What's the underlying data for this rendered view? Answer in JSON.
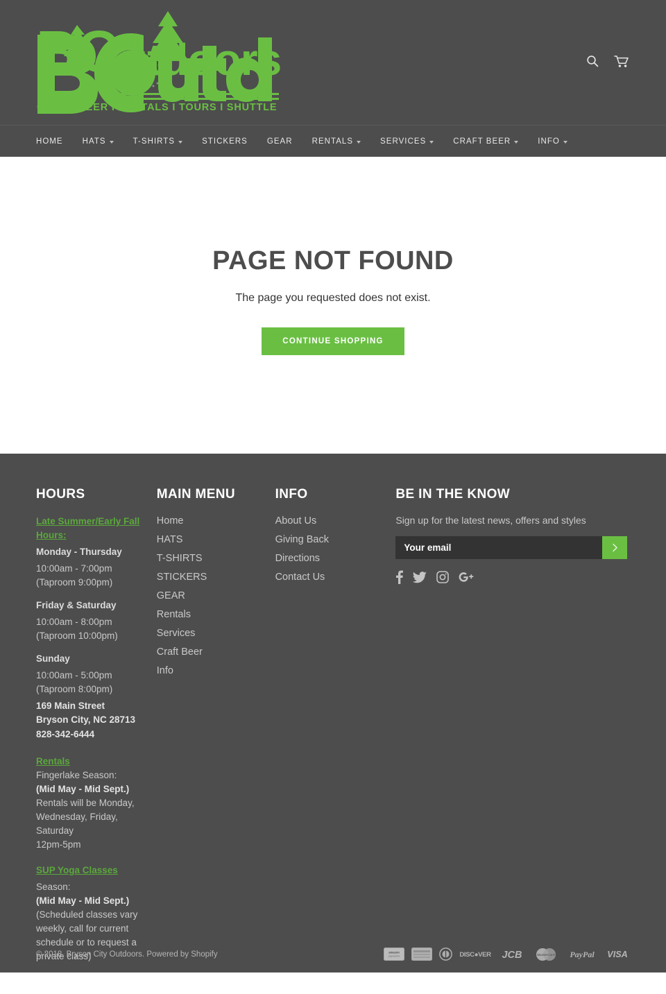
{
  "header": {
    "logo": {
      "brand_prefix": "BC",
      "brand_suffix": "utdoors",
      "brand_full": "BC Outdoors",
      "tagline": "GEAR I BEER I RENTALS I TOURS I SHUTTLE",
      "color": "#6ABF43"
    },
    "icons": {
      "search": "search-icon",
      "cart": "cart-icon"
    }
  },
  "nav": {
    "items": [
      {
        "label": "HOME",
        "has_dropdown": false
      },
      {
        "label": "HATS",
        "has_dropdown": true
      },
      {
        "label": "T-SHIRTS",
        "has_dropdown": true
      },
      {
        "label": "STICKERS",
        "has_dropdown": false
      },
      {
        "label": "GEAR",
        "has_dropdown": false
      },
      {
        "label": "RENTALS",
        "has_dropdown": true
      },
      {
        "label": "SERVICES",
        "has_dropdown": true
      },
      {
        "label": "CRAFT BEER",
        "has_dropdown": true
      },
      {
        "label": "INFO",
        "has_dropdown": true
      }
    ]
  },
  "main": {
    "title": "PAGE NOT FOUND",
    "subtitle": "The page you requested does not exist.",
    "cta_label": "CONTINUE SHOPPING",
    "cta_color": "#6ABF43"
  },
  "footer": {
    "hours": {
      "title": "HOURS",
      "season_link": "Late Summer/Early Fall Hours:",
      "blocks": [
        {
          "days": "Monday - Thursday",
          "time": "10:00am - 7:00pm",
          "taproom": "(Taproom 9:00pm)"
        },
        {
          "days": "Friday & Saturday",
          "time": "10:00am - 8:00pm",
          "taproom": "(Taproom 10:00pm)"
        },
        {
          "days": "Sunday",
          "time": "10:00am - 5:00pm",
          "taproom": "(Taproom 8:00pm)"
        }
      ],
      "address_line1": "169 Main Street",
      "address_line2": "Bryson City, NC 28713",
      "phone": "828-342-6444",
      "rentals_link": "Rentals",
      "rentals_season_label": "Fingerlake Season:",
      "rentals_season_dates": "(Mid May - Mid Sept.)",
      "rentals_detail_1": "Rentals will be Monday,",
      "rentals_detail_2": "Wednesday, Friday,",
      "rentals_detail_3": "Saturday",
      "rentals_detail_4": "12pm-5pm",
      "yoga_link": "SUP Yoga Classes",
      "yoga_season_label": "Season:",
      "yoga_season_dates": "(Mid May - Mid Sept.)",
      "yoga_note_1": "(Scheduled classes vary",
      "yoga_note_2": "weekly, call for current",
      "yoga_note_3": "schedule or to request a",
      "yoga_note_4": "private class)"
    },
    "main_menu": {
      "title": "MAIN MENU",
      "items": [
        "Home",
        "HATS",
        "T-SHIRTS",
        "STICKERS",
        "GEAR",
        "Rentals",
        "Services",
        "Craft Beer",
        "Info"
      ]
    },
    "info": {
      "title": "INFO",
      "items": [
        "About Us",
        "Giving Back",
        "Directions",
        "Contact Us"
      ]
    },
    "newsletter": {
      "title": "BE IN THE KNOW",
      "subtitle": "Sign up for the latest news, offers and styles",
      "email_placeholder": "Your email",
      "email_value": "",
      "submit_icon": "chevron-right-icon",
      "socials": [
        {
          "name": "facebook-icon",
          "label": "Facebook"
        },
        {
          "name": "twitter-icon",
          "label": "Twitter"
        },
        {
          "name": "instagram-icon",
          "label": "Instagram"
        },
        {
          "name": "google-plus-icon",
          "label": "Google Plus"
        }
      ]
    },
    "bottom": {
      "copyright": "© 2018, Bryson City Outdoors. Powered by ",
      "powered_by": "Shopify",
      "payments": [
        "amazon-payments-icon",
        "american-express-icon",
        "diners-club-icon",
        "discover-icon",
        "jcb-icon",
        "master-icon",
        "paypal-icon",
        "visa-icon"
      ]
    }
  }
}
